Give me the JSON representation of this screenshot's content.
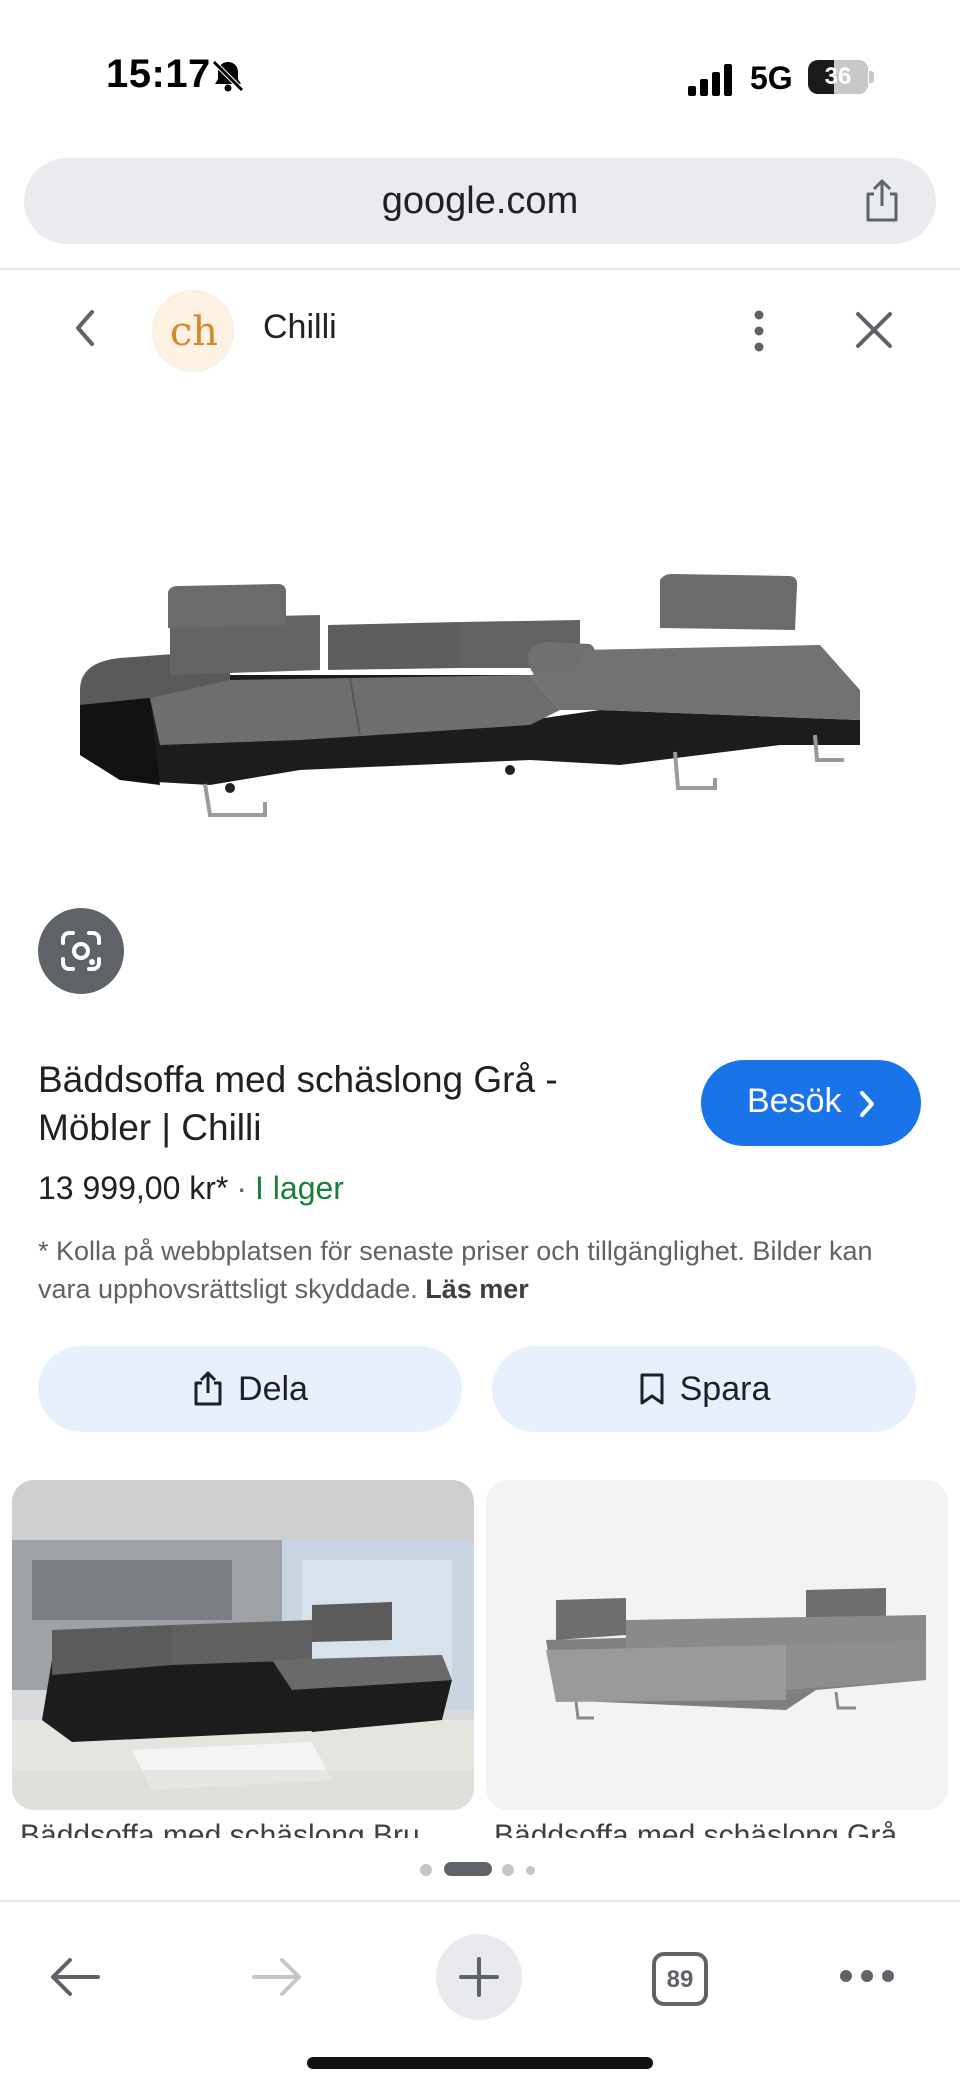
{
  "status_bar": {
    "time": "15:17",
    "network": "5G",
    "battery": "36",
    "icons": [
      "bell-slash-icon",
      "signal-icon",
      "battery-icon"
    ]
  },
  "browser": {
    "url": "google.com",
    "tab_count": "89",
    "icons": [
      "share-icon",
      "back-arrow-icon",
      "forward-arrow-icon",
      "new-tab-icon",
      "tabs-icon",
      "more-horizontal-icon"
    ]
  },
  "panel": {
    "site_logo_text": "ch",
    "site_name": "Chilli",
    "icons": [
      "chevron-left-icon",
      "more-vertical-icon",
      "close-icon",
      "lens-icon"
    ]
  },
  "product": {
    "title": "Bäddsoffa med schäslong Grå - Möbler | Chilli",
    "visit_label": "Besök",
    "price": "13 999,00 kr*",
    "separator": "·",
    "stock": "I lager",
    "disclaimer": "* Kolla på webbplatsen för senaste priser och tillgänglighet. Bilder kan vara upphovsrättsligt skyddade.",
    "read_more": "Läs mer"
  },
  "actions": {
    "share_label": "Dela",
    "save_label": "Spara"
  },
  "related": [
    {
      "caption": "Bäddsoffa med schäslong Bru"
    },
    {
      "caption": "Bäddsoffa med schäslong Grå"
    }
  ],
  "pager": {
    "pages": 4,
    "active": 1
  },
  "colors": {
    "accent": "#1a73e8",
    "chip_bg": "#e8f0fe",
    "stock_green": "#188038",
    "url_bar_bg": "#e9ebee"
  }
}
